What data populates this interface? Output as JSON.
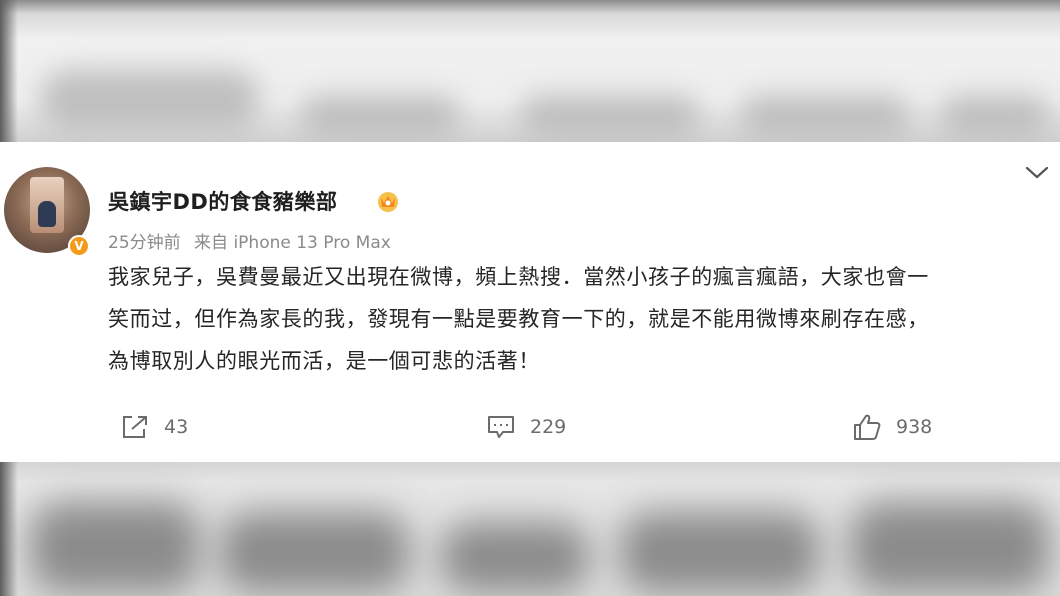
{
  "post": {
    "username": "吳鎮宇DD的食食豬樂部",
    "time": "25分钟前",
    "source": "来自 iPhone 13 Pro Max",
    "text_line1": "我家兒子，吳費曼最近又出現在微博，頻上熱搜．當然小孩子的瘋言瘋語，大家也會一",
    "text_line2": "笑而过，但作為家長的我，發現有一點是要教育一下的，就是不能用微博來刷存在感，",
    "text_line3": "為博取別人的眼光而活，是一個可悲的活著！",
    "verified_mark": "V"
  },
  "actions": {
    "repost_count": "43",
    "comment_count": "229",
    "like_count": "938"
  },
  "colors": {
    "verified": "#f39a1b",
    "vip": "#f5a623",
    "text": "#262626",
    "meta": "#8a8a8a"
  },
  "icons": [
    "avatar",
    "verified-icon",
    "vip-crown-icon",
    "chevron-down-icon",
    "repost-icon",
    "comment-icon",
    "like-icon"
  ]
}
